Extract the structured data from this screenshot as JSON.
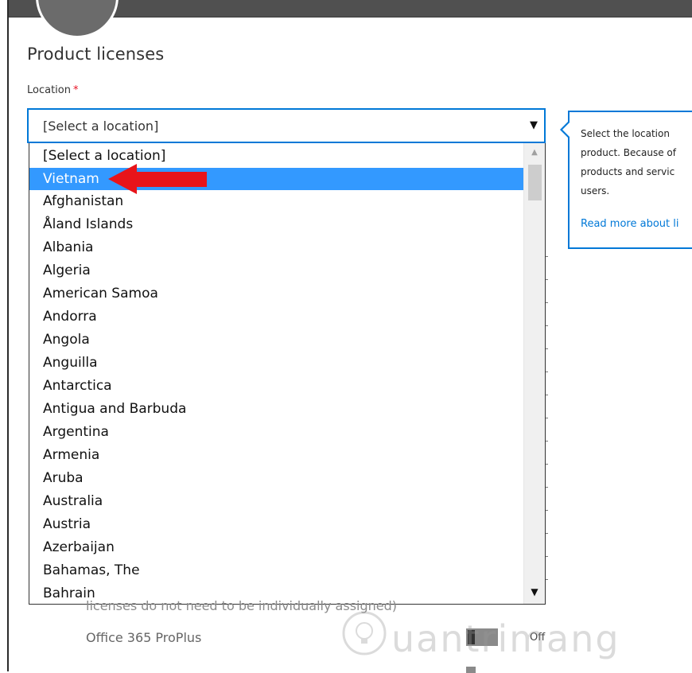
{
  "header": {
    "title": "Product licenses"
  },
  "location_field": {
    "label": "Location",
    "required_marker": "*",
    "selected_value": "[Select a location]"
  },
  "dropdown": {
    "options": [
      "[Select a location]",
      "Vietnam",
      "Afghanistan",
      "Åland Islands",
      "Albania",
      "Algeria",
      "American Samoa",
      "Andorra",
      "Angola",
      "Anguilla",
      "Antarctica",
      "Antigua and Barbuda",
      "Argentina",
      "Armenia",
      "Aruba",
      "Australia",
      "Austria",
      "Azerbaijan",
      "Bahamas, The",
      "Bahrain"
    ],
    "highlighted_option": "Vietnam"
  },
  "help_callout": {
    "text": "Select the location \nproduct. Because of\nproducts and servic\nusers.",
    "link_text": "Read more about li"
  },
  "background": {
    "partial_text": "licenses do not need to be individually assigned)",
    "product_name": "Office 365 ProPlus",
    "toggle_state": "Off"
  },
  "watermark": {
    "text": "uantrimang"
  },
  "colors": {
    "accent": "#0078d7",
    "selection": "#3399ff",
    "annotation_arrow": "#e8141a",
    "required": "#e81123"
  }
}
